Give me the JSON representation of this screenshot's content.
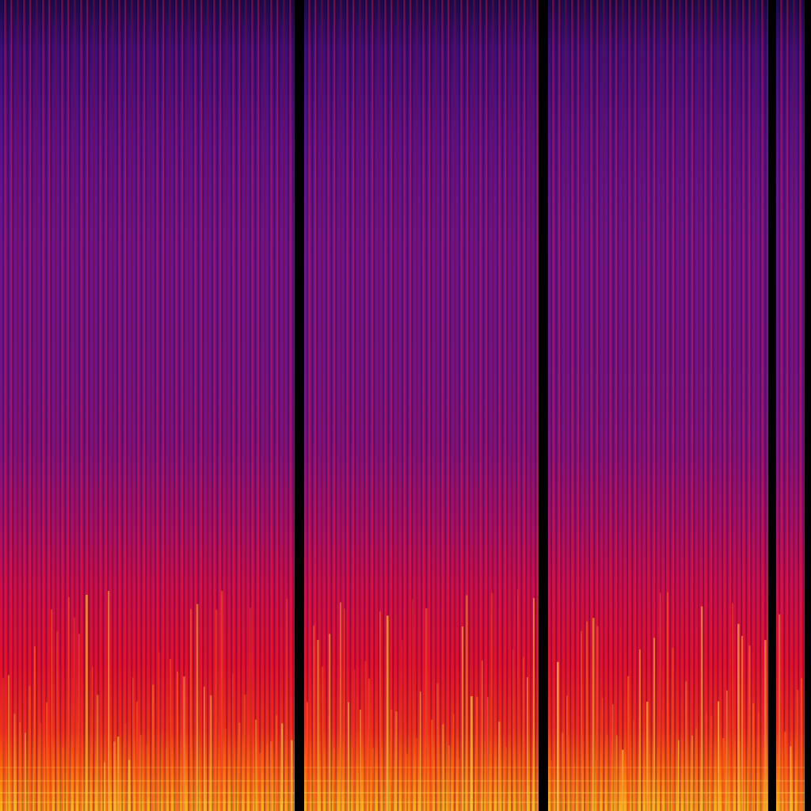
{
  "image": {
    "kind": "spectrogram",
    "colormap": "magma-like",
    "colors": {
      "background": "#000000",
      "low": "#1a0a4a",
      "mid": "#6a148c",
      "high": "#e2102e",
      "peak": "#ffb21a"
    }
  }
}
